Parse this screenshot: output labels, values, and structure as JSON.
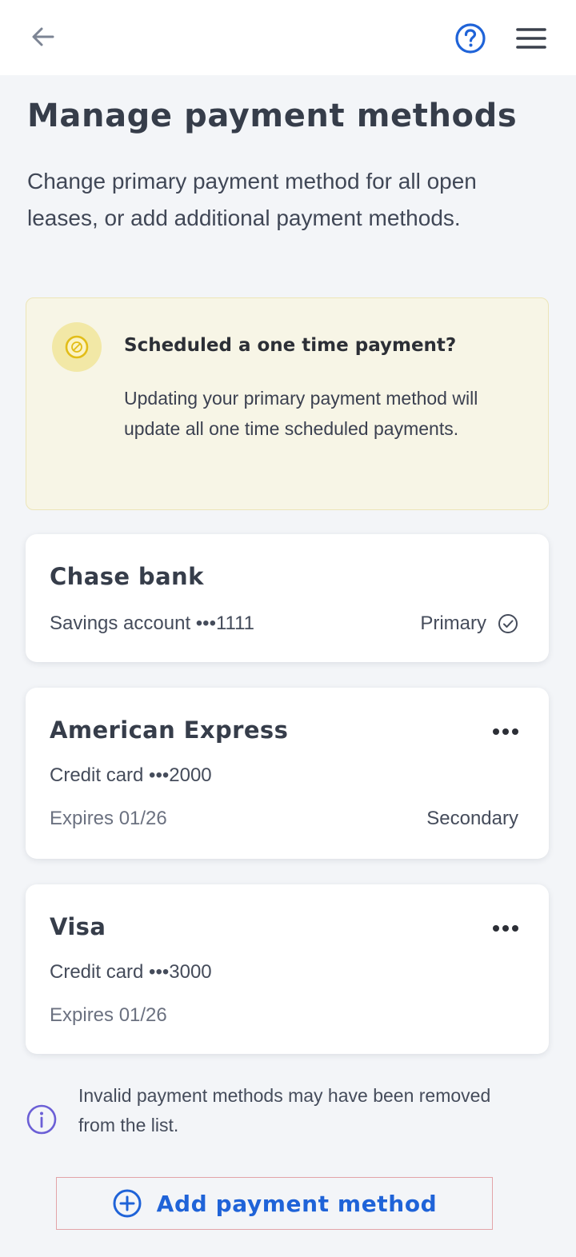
{
  "header": {
    "back_icon": "arrow-left-icon",
    "help_icon": "question-circle-icon",
    "menu_icon": "hamburger-menu-icon"
  },
  "page": {
    "title": "Manage payment methods",
    "description": "Change primary payment method for all open leases, or add additional payment methods."
  },
  "notice": {
    "icon": "no-symbol-icon",
    "title": "Scheduled a one time payment?",
    "body": "Updating your primary payment method will update all one time scheduled payments."
  },
  "payment_methods": [
    {
      "name": "Chase bank",
      "detail": "Savings account •••1111",
      "status": "Primary",
      "status_icon": "check-circle-icon"
    },
    {
      "name": "American Express",
      "detail": "Credit card •••2000",
      "expires": "Expires 01/26",
      "status": "Secondary",
      "more_icon": "more-dots-icon"
    },
    {
      "name": "Visa",
      "detail": "Credit card •••3000",
      "expires": "Expires 01/26",
      "more_icon": "more-dots-icon"
    }
  ],
  "info": {
    "icon": "info-circle-icon",
    "text": "Invalid payment methods may have been removed from the list."
  },
  "add_button": {
    "icon": "plus-circle-icon",
    "label": "Add payment method"
  },
  "colors": {
    "accent": "#1f63d8",
    "notice_bg": "#f7f5e6",
    "notice_icon": "#e2bd18",
    "info_icon": "#6b5fd6",
    "page_bg": "#f3f5f8"
  }
}
